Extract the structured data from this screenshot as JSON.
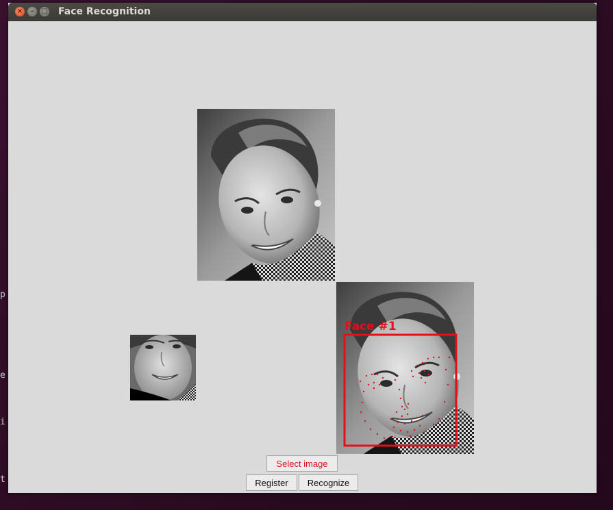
{
  "window": {
    "title": "Face Recognition",
    "close_glyph": "×",
    "min_glyph": "–",
    "max_glyph": "□"
  },
  "terminal_fragments": [
    "p",
    "e",
    "i",
    "t"
  ],
  "detection": {
    "label": "Face #1",
    "color": "#e3101c"
  },
  "buttons": {
    "select_image": "Select image",
    "register": "Register",
    "recognize": "Recognize"
  },
  "icons": {
    "photo_icon": "face-photo-icon"
  }
}
